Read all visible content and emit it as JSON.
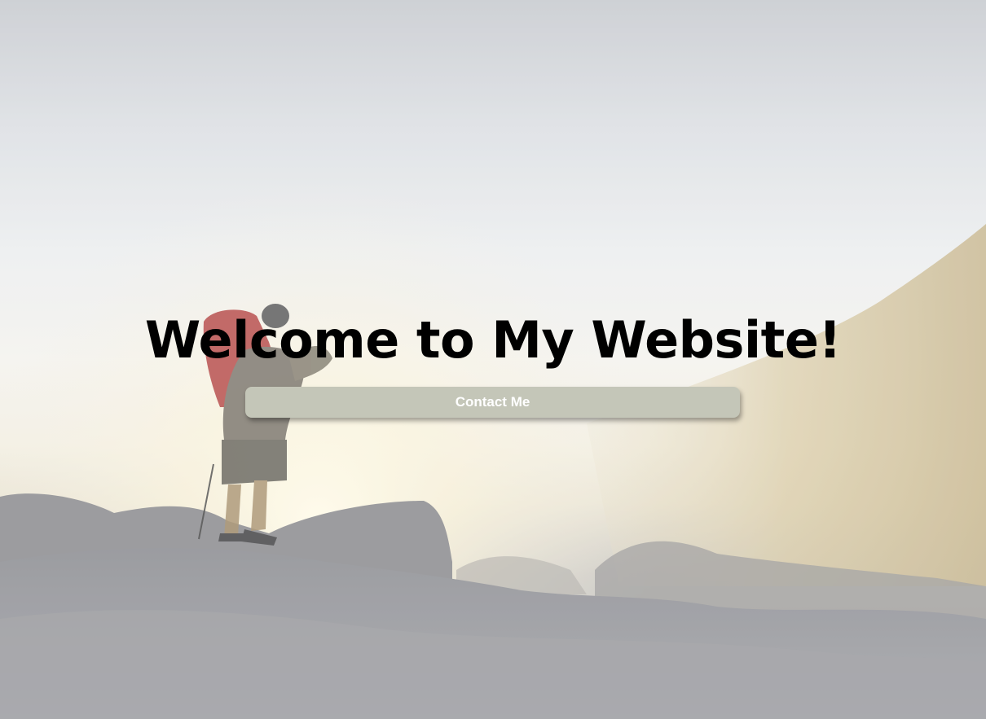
{
  "hero": {
    "background_image": "hiker-on-misty-mountain-at-sunrise",
    "headline": "Welcome to My Website!",
    "contact_button_label": "Contact Me"
  },
  "colors": {
    "headline_text": "#000000",
    "button_background": "#c4c6b8",
    "button_text": "#ffffff"
  }
}
